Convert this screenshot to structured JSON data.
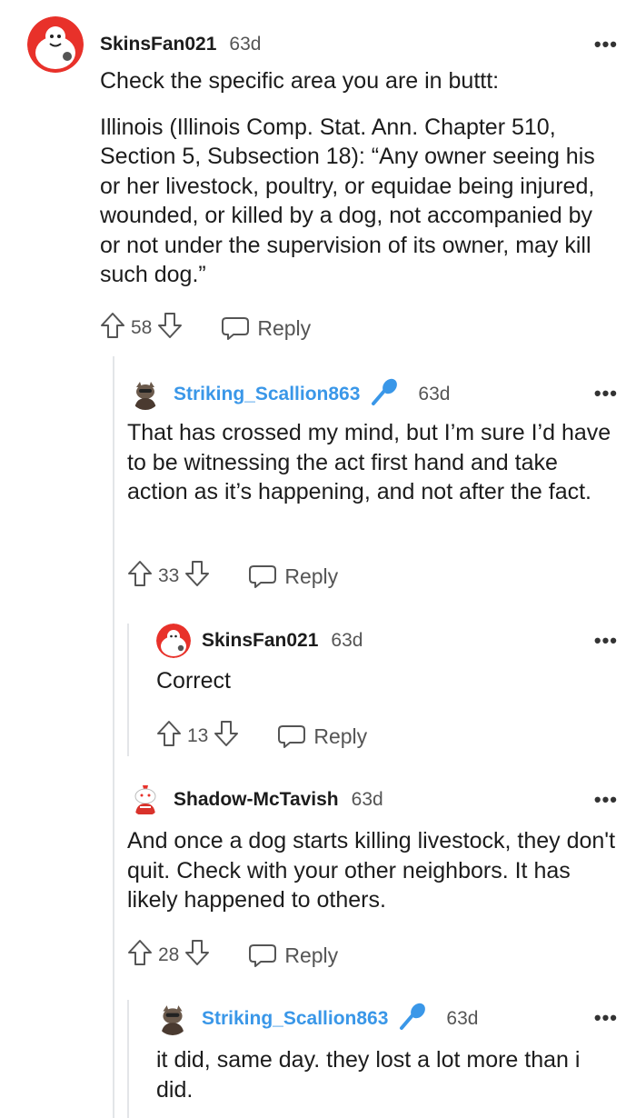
{
  "comments": [
    {
      "author": "SkinsFan021",
      "age": "63d",
      "body": [
        "Check the specific area you are in buttt:",
        "Illinois (Illinois Comp. Stat. Ann. Chapter 510, Section 5, Subsection 18):  “Any owner seeing his or her livestock, poultry, or equidae being injured, wounded, or killed by a dog, not accompanied by or not under the supervision of its owner, may kill such dog.”"
      ],
      "score": "58",
      "reply_label": "Reply"
    },
    {
      "author": "Striking_Scallion863",
      "age": "63d",
      "body": [
        "That has crossed my mind, but I’m sure I’d have to be witnessing the act first hand and take action as it’s happening, and not after the fact."
      ],
      "score": "33",
      "reply_label": "Reply"
    },
    {
      "author": "SkinsFan021",
      "age": "63d",
      "body": [
        "Correct"
      ],
      "score": "13",
      "reply_label": "Reply"
    },
    {
      "author": "Shadow-McTavish",
      "age": "63d",
      "body": [
        "And once a dog starts killing livestock, they don't quit. Check with your other neighbors. It has likely happened to others."
      ],
      "score": "28",
      "reply_label": "Reply"
    },
    {
      "author": "Striking_Scallion863",
      "age": "63d",
      "body": [
        "it did, same day. they lost a lot more than i did."
      ]
    }
  ],
  "more_label": "•••",
  "colors": {
    "op_author": "#3a97e8",
    "thread_line": "#e3e5e8"
  }
}
